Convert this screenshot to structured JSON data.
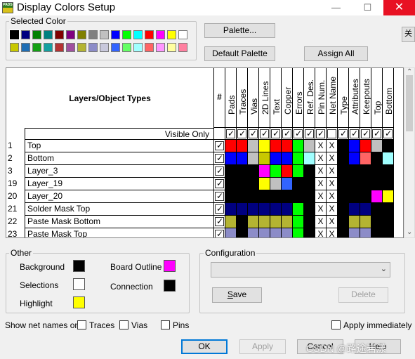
{
  "window": {
    "title": "Display Colors Setup",
    "icon_text": "PADS",
    "minimize": "—",
    "maximize": "☐",
    "close": "✕"
  },
  "selected_color": {
    "label": "Selected Color",
    "palette_row1": [
      "#000000",
      "#000080",
      "#008000",
      "#008080",
      "#800000",
      "#800080",
      "#808000",
      "#808080",
      "#c0c0c0",
      "#0000ff",
      "#00ff00",
      "#00ffff",
      "#ff0000",
      "#ff00ff",
      "#ffff00",
      "#ffffff"
    ],
    "palette_row2": [
      "#c8c800",
      "#1e6eb4",
      "#14a014",
      "#14a0a0",
      "#b43232",
      "#a050a0",
      "#b4b432",
      "#8c8cc8",
      "#c8c8dc",
      "#3264ff",
      "#64ff64",
      "#a0ffff",
      "#ff6464",
      "#ff96ff",
      "#ffffa0",
      "#ff80a0"
    ],
    "palette_button": "Palette...",
    "default_palette_button": "Default Palette",
    "assign_all_button": "Assign All",
    "side_button": "关"
  },
  "table": {
    "header_title": "Layers/Object Types",
    "hash": "#",
    "columns": [
      "Pads",
      "Traces",
      "Vias",
      "2D Lines",
      "Text",
      "Copper",
      "Errors",
      "Ref. Des.",
      "Pin Num.",
      "Net Name",
      "Type",
      "Attributes",
      "Keepouts",
      "Top",
      "Bottom"
    ],
    "visible_only_label": "Visible Only",
    "visible_only_checks": [
      true,
      true,
      true,
      true,
      true,
      true,
      true,
      true,
      true,
      false,
      true,
      true,
      true,
      true,
      true
    ],
    "rows": [
      {
        "num": "1",
        "name": "Top",
        "colors": [
          "#ff0000",
          "#ff0000",
          "#c0c0c0",
          "#ffff00",
          "#ff0000",
          "#ff0000",
          "#00ff00",
          "#c0c0c0",
          "X",
          "X",
          "#000000",
          "#0000ff",
          "#ff0000",
          "#c0c0c0",
          "#000000"
        ]
      },
      {
        "num": "2",
        "name": "Bottom",
        "colors": [
          "#0000ff",
          "#0000ff",
          "#c0c0c0",
          "#c8c800",
          "#0000ff",
          "#0000ff",
          "#00ff00",
          "#a0ffff",
          "X",
          "X",
          "#000000",
          "#0000ff",
          "#ff6464",
          "#000000",
          "#a0ffff"
        ]
      },
      {
        "num": "3",
        "name": "Layer_3",
        "colors": [
          "#000000",
          "#000000",
          "#000000",
          "#ff00ff",
          "#00ff00",
          "#ff0000",
          "#00ff00",
          "#000000",
          "X",
          "X",
          "#000000",
          "#000000",
          "#000000",
          "#000000",
          "#000000"
        ]
      },
      {
        "num": "19",
        "name": "Layer_19",
        "colors": [
          "#000000",
          "#000000",
          "#000000",
          "#ffff00",
          "#c0c0c0",
          "#3264ff",
          "#000000",
          "#000000",
          "X",
          "X",
          "#000000",
          "#000000",
          "#000000",
          "#000000",
          "#000000"
        ]
      },
      {
        "num": "20",
        "name": "Layer_20",
        "colors": [
          "#000000",
          "#000000",
          "#000000",
          "#000000",
          "#000000",
          "#000000",
          "#000000",
          "#000000",
          "X",
          "X",
          "#000000",
          "#000000",
          "#000000",
          "#ff00ff",
          "#ffff00"
        ]
      },
      {
        "num": "21",
        "name": "Solder Mask Top",
        "colors": [
          "#000080",
          "#000080",
          "#000080",
          "#000080",
          "#000080",
          "#000080",
          "#00ff00",
          "#000000",
          "X",
          "X",
          "#000000",
          "#000080",
          "#000080",
          "#000000",
          "#000000"
        ]
      },
      {
        "num": "22",
        "name": "Paste Mask Bottom",
        "colors": [
          "#b4b432",
          "#000000",
          "#b4b432",
          "#b4b432",
          "#b4b432",
          "#b4b432",
          "#00ff00",
          "#000000",
          "X",
          "X",
          "#000000",
          "#b4b432",
          "#b4b432",
          "#000000",
          "#000000"
        ]
      },
      {
        "num": "23",
        "name": "Paste Mask Top",
        "colors": [
          "#8c8cc8",
          "#000000",
          "#8c8cc8",
          "#8c8cc8",
          "#8c8cc8",
          "#8c8cc8",
          "#00ff00",
          "#000000",
          "X",
          "X",
          "#000000",
          "#8c8cc8",
          "#8c8cc8",
          "#000000",
          "#000000"
        ]
      }
    ],
    "row_checks": [
      true,
      true,
      true,
      true,
      true,
      true,
      true,
      true
    ]
  },
  "other": {
    "label": "Other",
    "background": {
      "label": "Background",
      "color": "#000000"
    },
    "selections": {
      "label": "Selections",
      "color": "#ffffff"
    },
    "highlight": {
      "label": "Highlight",
      "color": "#ffff00"
    },
    "board_outline": {
      "label": "Board Outline",
      "color": "#ff00ff"
    },
    "connection": {
      "label": "Connection",
      "color": "#000000"
    }
  },
  "configuration": {
    "label": "Configuration",
    "dropdown_value": "",
    "save_button": "Save",
    "delete_button": "Delete"
  },
  "net_names": {
    "label": "Show net names on",
    "traces": "Traces",
    "vias": "Vias",
    "pins": "Pins",
    "apply_immediately": "Apply immediately"
  },
  "buttons": {
    "ok": "OK",
    "apply": "Apply",
    "cancel": "Cancel",
    "help": "Help"
  },
  "watermark": "CSDN @路途岩漾"
}
